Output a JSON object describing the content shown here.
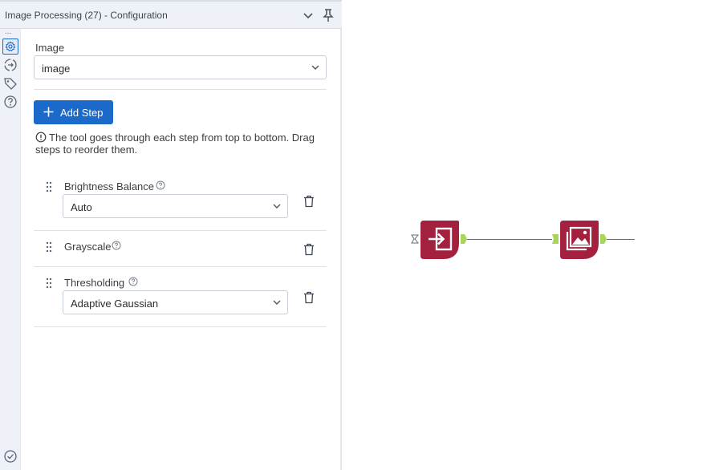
{
  "panel": {
    "title": "Image Processing (27) - Configuration",
    "image_label": "Image",
    "image_value": "image",
    "add_step_label": "Add Step",
    "info_text": "The tool goes through each step from top to bottom. Drag steps to reorder them."
  },
  "steps": [
    {
      "name": "Brightness Balance",
      "value": "Auto"
    },
    {
      "name": "Grayscale"
    },
    {
      "name": "Thresholding",
      "value": "Adaptive Gaussian"
    }
  ],
  "sidebar": {
    "dots": "...",
    "icons": [
      "gear-icon",
      "connection-icon",
      "tag-icon",
      "help-icon",
      "check-circle-icon"
    ]
  },
  "canvas": {
    "tools": [
      {
        "icon": "input-data-icon",
        "color": "#a3203f"
      },
      {
        "icon": "image-processing-icon",
        "color": "#a3203f"
      }
    ],
    "anchor_color": "#a8d55a"
  },
  "colors": {
    "accent": "#1b6ac9",
    "tool": "#a3203f"
  }
}
